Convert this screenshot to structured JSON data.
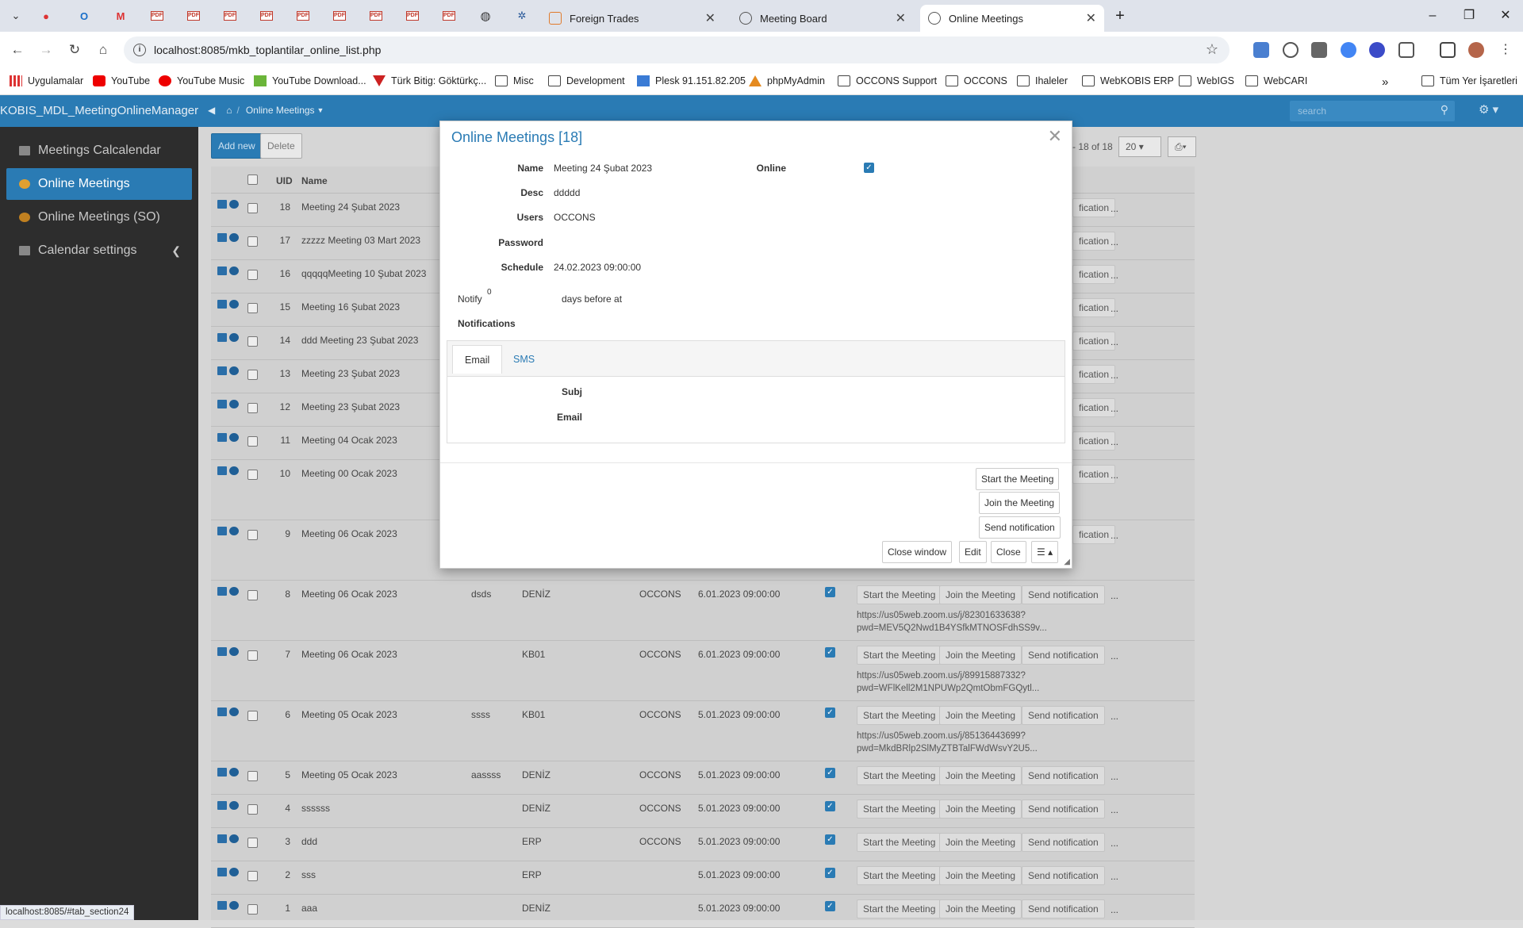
{
  "browser": {
    "tabs": [
      {
        "label": "Foreign Trades",
        "active": false
      },
      {
        "label": "Meeting Board",
        "active": false
      },
      {
        "label": "Online Meetings",
        "active": true
      }
    ],
    "url": "localhost:8085/mkb_toplantilar_online_list.php",
    "bookmarks": [
      "Uygulamalar",
      "YouTube",
      "YouTube Music",
      "YouTube Download...",
      "Türk Bitig: Göktürkç...",
      "Misc",
      "Development",
      "Plesk 91.151.82.205",
      "phpMyAdmin",
      "OCCONS Support",
      "OCCONS",
      "Ihaleler",
      "WebKOBIS ERP",
      "WebIGS",
      "WebCARI"
    ],
    "other_bookmarks": "Tüm Yer İşaretleri",
    "status_url": "localhost:8085/#tab_section24"
  },
  "app": {
    "title": "KOBIS_MDL_MeetingOnlineManager",
    "breadcrumb": "Online Meetings",
    "search_placeholder": "search"
  },
  "sidebar": {
    "items": [
      {
        "label": "Meetings Calcalendar",
        "active": false
      },
      {
        "label": "Online Meetings",
        "active": true
      },
      {
        "label": "Online Meetings (SO)",
        "active": false
      },
      {
        "label": "Calendar settings",
        "active": false
      }
    ]
  },
  "toolbar": {
    "add_new": "Add new",
    "delete": "Delete",
    "pager_text": "- 18 of 18",
    "page_size": "20"
  },
  "grid": {
    "headers": {
      "uid": "UID",
      "name": "Name"
    },
    "row_buttons": {
      "start": "Start the Meeting",
      "join": "Join the Meeting",
      "notify": "Send notification",
      "notify_partial": "fication",
      "more": "..."
    },
    "rows": [
      {
        "uid": "18",
        "name": "Meeting 24 Şubat 2023"
      },
      {
        "uid": "17",
        "name": "zzzzz Meeting 03 Mart 2023"
      },
      {
        "uid": "16",
        "name": "qqqqqMeeting 10 Şubat 2023"
      },
      {
        "uid": "15",
        "name": "Meeting 16 Şubat 2023"
      },
      {
        "uid": "14",
        "name": "ddd Meeting 23 Şubat 2023"
      },
      {
        "uid": "13",
        "name": "Meeting 23 Şubat 2023"
      },
      {
        "uid": "12",
        "name": "Meeting 23 Şubat 2023"
      },
      {
        "uid": "11",
        "name": "Meeting 04 Ocak 2023"
      },
      {
        "uid": "10",
        "name": "Meeting 00 Ocak 2023"
      },
      {
        "uid": "9",
        "name": "Meeting 06 Ocak 2023"
      },
      {
        "uid": "8",
        "name": "Meeting 06 Ocak 2023",
        "desc": "dsds",
        "users": "DENİZ",
        "company": "OCCONS",
        "schedule": "6.01.2023 09:00:00",
        "link1": "https://us05web.zoom.us/j/82301633638?",
        "link2": "pwd=MEV5Q2Nwd1B4YSfkMTNOSFdhSS9v..."
      },
      {
        "uid": "7",
        "name": "Meeting 06 Ocak 2023",
        "desc": "",
        "users": "KB01",
        "company": "OCCONS",
        "schedule": "6.01.2023 09:00:00",
        "link1": "https://us05web.zoom.us/j/89915887332?",
        "link2": "pwd=WFlKell2M1NPUWp2QmtObmFGQytl..."
      },
      {
        "uid": "6",
        "name": "Meeting 05 Ocak 2023",
        "desc": "ssss",
        "users": "KB01",
        "company": "OCCONS",
        "schedule": "5.01.2023 09:00:00",
        "link1": "https://us05web.zoom.us/j/85136443699?",
        "link2": "pwd=MkdBRlp2SlMyZTBTalFWdWsvY2U5..."
      },
      {
        "uid": "5",
        "name": "Meeting 05 Ocak 2023",
        "desc": "aassss",
        "users": "DENİZ",
        "company": "OCCONS",
        "schedule": "5.01.2023 09:00:00"
      },
      {
        "uid": "4",
        "name": "ssssss",
        "desc": "",
        "users": "DENİZ",
        "company": "OCCONS",
        "schedule": "5.01.2023 09:00:00"
      },
      {
        "uid": "3",
        "name": "ddd",
        "desc": "",
        "users": "ERP",
        "company": "OCCONS",
        "schedule": "5.01.2023 09:00:00"
      },
      {
        "uid": "2",
        "name": "sss",
        "desc": "",
        "users": "ERP",
        "company": "",
        "schedule": "5.01.2023 09:00:00"
      },
      {
        "uid": "1",
        "name": "aaa",
        "desc": "",
        "users": "DENİZ",
        "company": "",
        "schedule": "5.01.2023 09:00:00"
      }
    ]
  },
  "modal": {
    "title": "Online Meetings [18]",
    "fields": {
      "name_label": "Name",
      "name_value": "Meeting 24 Şubat 2023",
      "online_label": "Online",
      "desc_label": "Desc",
      "desc_value": "ddddd",
      "users_label": "Users",
      "users_value": "OCCONS",
      "password_label": "Password",
      "password_value": "",
      "schedule_label": "Schedule",
      "schedule_value": "24.02.2023 09:00:00",
      "notify_label": "Notify",
      "notify_value": "0",
      "notify_suffix": "days before at",
      "notifications_label": "Notifications"
    },
    "tabs": [
      {
        "label": "Email",
        "active": true
      },
      {
        "label": "SMS",
        "active": false
      }
    ],
    "email_pane": {
      "subj_label": "Subj",
      "email_label": "Email"
    },
    "actions": {
      "start": "Start the Meeting",
      "join": "Join the Meeting",
      "notify": "Send notification",
      "close_window": "Close window",
      "edit": "Edit",
      "close": "Close",
      "menu": "☰ ▴"
    }
  },
  "colors": {
    "brand": "#2a7bb4",
    "sidebar": "#2d2d2d"
  }
}
